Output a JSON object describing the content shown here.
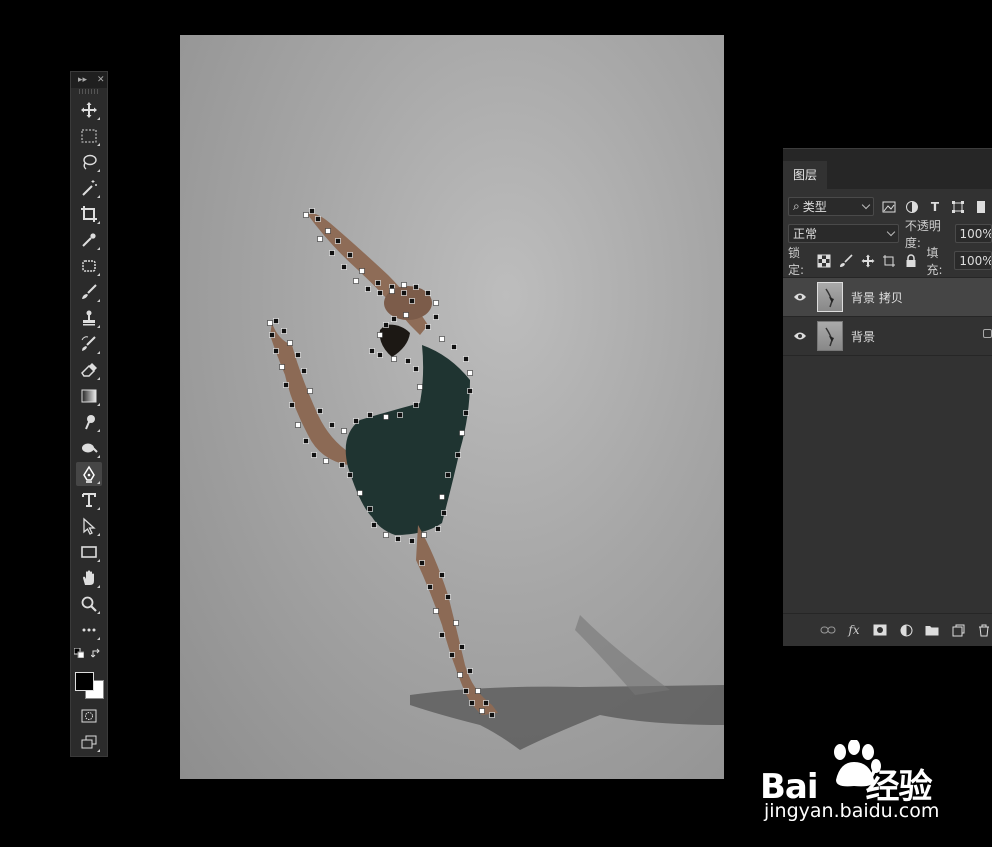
{
  "layers_panel": {
    "tab": "图层",
    "filter_label": "类型",
    "blend_mode": "正常",
    "opacity_label": "不透明度:",
    "opacity_value": "100%",
    "lock_label": "锁定:",
    "fill_label": "填充:",
    "fill_value": "100%",
    "layers": [
      {
        "name": "背景 拷贝",
        "selected": true
      },
      {
        "name": "背景",
        "selected": false
      }
    ]
  },
  "watermark": {
    "brand_left": "Bai",
    "brand_right": "经验",
    "url": "jingyan.baidu.com"
  },
  "colors": {
    "panel_bg": "#323232",
    "panel_dark": "#262626",
    "selected_layer": "#454545",
    "dress": "#1f3431"
  }
}
